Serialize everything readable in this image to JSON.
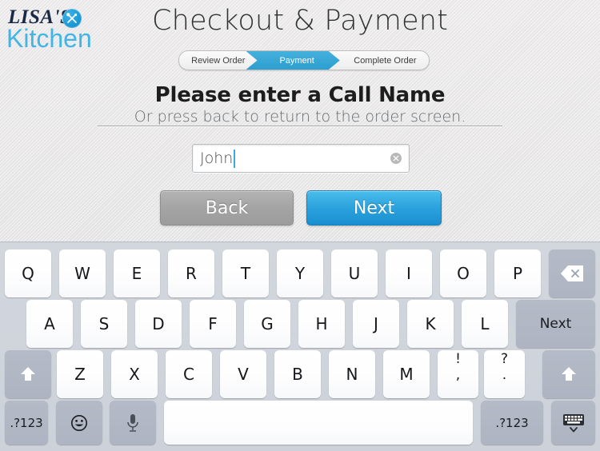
{
  "brand": {
    "line1": "LISA'S",
    "line2": "Kitchen",
    "badge_icon": "crossed-utensils-icon",
    "accent_color": "#41b6e6",
    "dark_color": "#182a46"
  },
  "header": {
    "title": "Checkout & Payment"
  },
  "breadcrumb": {
    "steps": [
      {
        "label": "Review Order",
        "active": false
      },
      {
        "label": "Payment",
        "active": true
      },
      {
        "label": "Complete Order",
        "active": false
      }
    ],
    "active_color": "#2ba2dd"
  },
  "prompt": {
    "heading": "Please enter a Call Name",
    "subheading": "Or press back to return to the order screen."
  },
  "call_name_field": {
    "value": "John",
    "placeholder": "",
    "clear_icon": "clear-circle-icon"
  },
  "actions": {
    "back_label": "Back",
    "next_label": "Next",
    "back_color": "#a4a4a4",
    "next_color": "#2ba2dd"
  },
  "keyboard": {
    "row1": [
      "Q",
      "W",
      "E",
      "R",
      "T",
      "Y",
      "U",
      "I",
      "O",
      "P"
    ],
    "row1_action": {
      "label": "",
      "icon": "backspace-icon"
    },
    "row2": [
      "A",
      "S",
      "D",
      "F",
      "G",
      "H",
      "J",
      "K",
      "L"
    ],
    "row2_action": {
      "label": "Next",
      "icon": "return-key"
    },
    "row3_letters": [
      "Z",
      "X",
      "C",
      "V",
      "B",
      "N",
      "M"
    ],
    "row3_punct": [
      {
        "upper": "!",
        "lower": ","
      },
      {
        "upper": "?",
        "lower": "."
      }
    ],
    "shift_left": {
      "icon": "shift-up-arrow-icon"
    },
    "shift_right": {
      "icon": "shift-up-arrow-icon"
    },
    "row4": {
      "numeric_left": ".?123",
      "emoji": {
        "icon": "smiley-face-icon"
      },
      "dictation": {
        "icon": "microphone-icon"
      },
      "space": "",
      "numeric_right": ".?123",
      "hide": {
        "icon": "hide-keyboard-icon"
      }
    }
  }
}
